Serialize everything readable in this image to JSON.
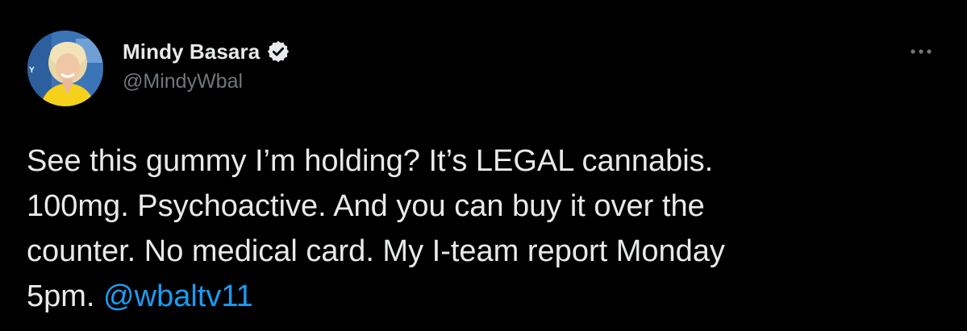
{
  "tweet": {
    "author": {
      "display_name": "Mindy Basara",
      "handle": "@MindyWbal",
      "verified": true,
      "verified_icon": "verified-badge-icon",
      "avatar_icon": "profile-photo"
    },
    "more_icon": "more-options-icon",
    "text_line_1": "See this gummy I’m holding? It’s LEGAL cannabis.",
    "text_line_2": "100mg. Psychoactive. And you can buy it over the",
    "text_line_3": "counter. No medical card. My I-team report Monday",
    "text_line_4": "5pm. ",
    "mention": "@wbaltv11"
  },
  "colors": {
    "background": "#000000",
    "primary_text": "#e7e9ea",
    "secondary_text": "#71767b",
    "link": "#1d9bf0"
  }
}
